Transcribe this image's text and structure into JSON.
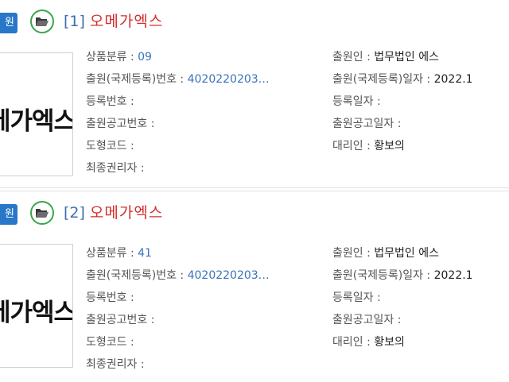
{
  "records": [
    {
      "badge": "원",
      "index": "[1]",
      "name": "오메가엑스",
      "logo_text": "메가엑스",
      "fields_left": [
        {
          "label": "상품분류 : ",
          "value": "09"
        },
        {
          "label": "출원(국제등록)번호 : ",
          "value": "4020220203…"
        },
        {
          "label": "등록번호 : ",
          "value": ""
        },
        {
          "label": "출원공고번호 : ",
          "value": ""
        },
        {
          "label": "도형코드 : ",
          "value": ""
        },
        {
          "label": "최종권리자 : ",
          "value": ""
        }
      ],
      "fields_right": [
        {
          "label": "출원인 : ",
          "value": "법무법인 에스"
        },
        {
          "label": "출원(국제등록)일자 : ",
          "value": "2022.1"
        },
        {
          "label": "등록일자 : ",
          "value": ""
        },
        {
          "label": "출원공고일자 : ",
          "value": ""
        },
        {
          "label": "대리인 : ",
          "value": "황보의"
        }
      ]
    },
    {
      "badge": "원",
      "index": "[2]",
      "name": "오메가엑스",
      "logo_text": "메가엑스",
      "fields_left": [
        {
          "label": "상품분류 : ",
          "value": "41"
        },
        {
          "label": "출원(국제등록)번호 : ",
          "value": "4020220203…"
        },
        {
          "label": "등록번호 : ",
          "value": ""
        },
        {
          "label": "출원공고번호 : ",
          "value": ""
        },
        {
          "label": "도형코드 : ",
          "value": ""
        },
        {
          "label": "최종권리자 : ",
          "value": ""
        }
      ],
      "fields_right": [
        {
          "label": "출원인 : ",
          "value": "법무법인 에스"
        },
        {
          "label": "출원(국제등록)일자 : ",
          "value": "2022.1"
        },
        {
          "label": "등록일자 : ",
          "value": ""
        },
        {
          "label": "출원공고일자 : ",
          "value": ""
        },
        {
          "label": "대리인 : ",
          "value": "황보의"
        }
      ]
    }
  ],
  "icons": {
    "open": "folder-open-icon"
  },
  "colors": {
    "badge": "#2877c8",
    "title_index": "#3b6fb0",
    "title_name": "#d32d2d",
    "folder_ring": "#3aa64a",
    "value_blue": "#3a73b8"
  }
}
